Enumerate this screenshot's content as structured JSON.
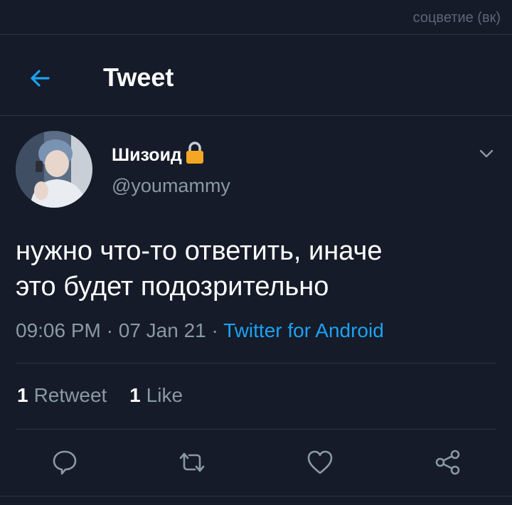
{
  "watermark": "соцветие (вк)",
  "header": {
    "title": "Tweet"
  },
  "tweet": {
    "author_name": "Шизоид",
    "author_handle": "@youmammy",
    "text_line1": "нужно что-то ответить, иначе",
    "text_line2": "это будет подозрительно",
    "time": "09:06 PM",
    "date": "07 Jan 21",
    "separator": " · ",
    "source": "Twitter for Android"
  },
  "stats": {
    "retweet_count": "1",
    "retweet_label": "Retweet",
    "like_count": "1",
    "like_label": "Like"
  },
  "colors": {
    "background": "#151b28",
    "accent": "#1da1f2",
    "secondary_text": "#8b98a5",
    "divider": "#2b3444",
    "lock": "#f5a623"
  },
  "icons": {
    "back": "arrow-left-icon",
    "lock": "lock-icon",
    "chevron": "chevron-down-icon",
    "reply": "reply-icon",
    "retweet": "retweet-icon",
    "like": "heart-icon",
    "share": "share-icon"
  }
}
